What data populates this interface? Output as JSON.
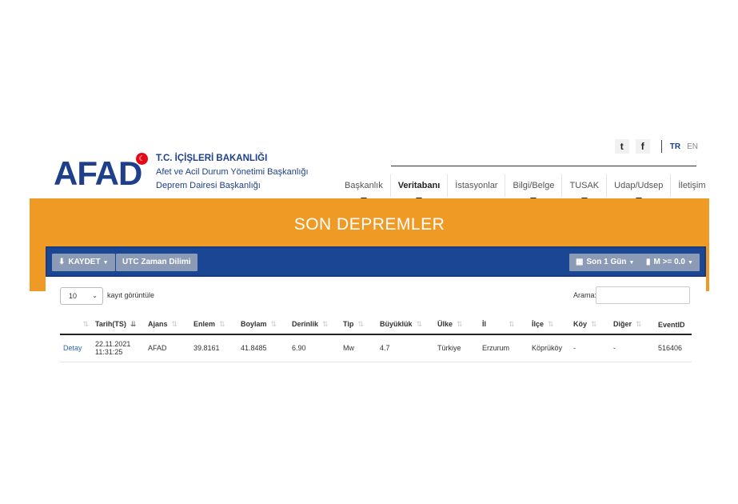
{
  "header": {
    "logo": "AFAD",
    "ministry_line1": "T.C. İÇİŞLERİ BAKANLIĞI",
    "ministry_line2": "Afet ve Acil Durum Yönetimi Başkanlığı",
    "ministry_line3": "Deprem Dairesi Başkanlığı",
    "twitter": "t",
    "facebook": "f",
    "lang_tr": "TR",
    "lang_en": "EN"
  },
  "nav": {
    "items": [
      "Başkanlık",
      "Veritabanı",
      "İstasyonlar",
      "Bilgi/Belge",
      "TUSAK",
      "Udap/Udsep",
      "İletişim"
    ]
  },
  "banner": {
    "title": "SON DEPREMLER"
  },
  "toolbar": {
    "save": "KAYDET",
    "utc": "UTC Zaman Dilimi",
    "period": "Son 1 Gün",
    "magnitude": "M >= 0.0"
  },
  "controls": {
    "page_length": "10",
    "page_length_label": "kayıt görüntüle",
    "search_label": "Arama:",
    "search_value": ""
  },
  "table": {
    "headers": [
      "",
      "Tarih(TS)",
      "Ajans",
      "Enlem",
      "Boylam",
      "Derinlik",
      "Tip",
      "Büyüklük",
      "Ülke",
      "İl",
      "İlçe",
      "Köy",
      "Diğer",
      "EventID"
    ],
    "rows": [
      {
        "detail": "Detay",
        "date": "22.11.2021",
        "time": "11:31:25",
        "agency": "AFAD",
        "lat": "39.8161",
        "lon": "41.8485",
        "depth": "6.90",
        "type": "Mw",
        "magnitude": "4.7",
        "country": "Türkiye",
        "province": "Erzurum",
        "district": "Köprüköy",
        "village": "-",
        "other": "-",
        "event_id": "516406"
      }
    ]
  }
}
